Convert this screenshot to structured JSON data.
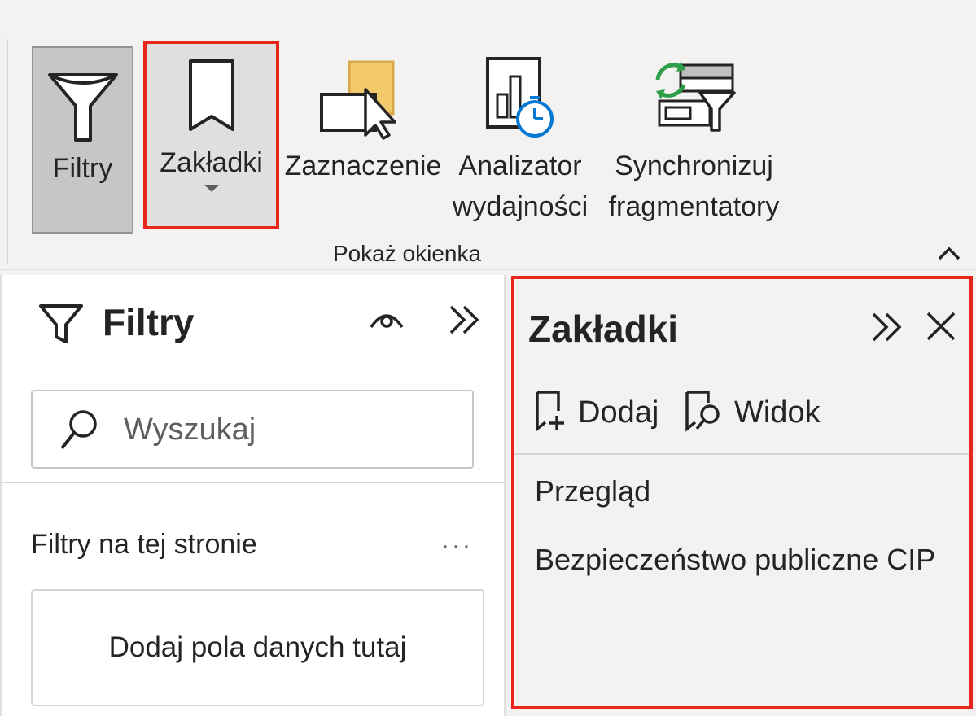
{
  "ribbon": {
    "buttons": {
      "filtry": "Filtry",
      "zakladki": "Zakładki",
      "zaznaczenie": "Zaznaczenie",
      "analizator_line1": "Analizator",
      "analizator_line2": "wydajności",
      "synchronizuj_line1": "Synchronizuj",
      "synchronizuj_line2": "fragmentatory"
    },
    "group_label": "Pokaż okienka",
    "icons": [
      "funnel-icon",
      "bookmark-icon",
      "selection-icon",
      "performance-analyzer-icon",
      "sync-slicers-icon",
      "chevron-up-icon"
    ],
    "colors": {
      "highlight": "#e8261c",
      "selection_fill": "#f2c96b",
      "accent_blue": "#0078d4",
      "accent_green": "#2e9e48"
    }
  },
  "filters_pane": {
    "title": "Filtry",
    "search_placeholder": "Wyszukaj",
    "section_title": "Filtry na tej stronie",
    "more": "···",
    "drop_zone": "Dodaj pola danych tutaj",
    "icons": [
      "funnel-icon",
      "eye-icon",
      "expand-icon",
      "search-icon"
    ]
  },
  "bookmarks_pane": {
    "title": "Zakładki",
    "add_label": "Dodaj",
    "view_label": "Widok",
    "items": [
      "Przegląd",
      "Bezpieczeństwo publiczne CIP"
    ],
    "icons": [
      "expand-icon",
      "close-icon",
      "add-bookmark-icon",
      "view-bookmark-icon"
    ]
  }
}
